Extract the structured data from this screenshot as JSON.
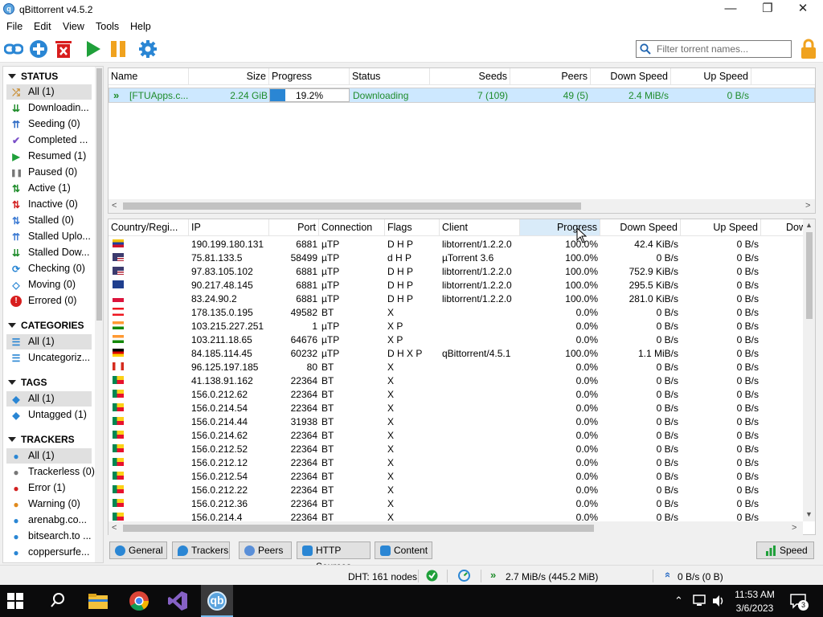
{
  "window": {
    "title": "qBittorrent v4.5.2",
    "minimize": "—",
    "maximize": "❐",
    "close": "✕"
  },
  "menu": [
    "File",
    "Edit",
    "View",
    "Tools",
    "Help"
  ],
  "filter": {
    "placeholder": "Filter torrent names..."
  },
  "sidebar": {
    "status_header": "STATUS",
    "status": [
      {
        "label": "All (1)",
        "icon": "shuffle-icon",
        "color": "#c98a2a"
      },
      {
        "label": "Downloadin...",
        "icon": "download-icon",
        "color": "#1f8c2b"
      },
      {
        "label": "Seeding (0)",
        "icon": "upload-icon",
        "color": "#2f6cc5"
      },
      {
        "label": "Completed ...",
        "icon": "check-icon",
        "color": "#7a4fc8"
      },
      {
        "label": "Resumed (1)",
        "icon": "play-icon",
        "color": "#1fa03a"
      },
      {
        "label": "Paused (0)",
        "icon": "pause-icon",
        "color": "#777777"
      },
      {
        "label": "Active (1)",
        "icon": "active-arrows-icon",
        "color": "#1f8c2b"
      },
      {
        "label": "Inactive (0)",
        "icon": "inactive-arrows-icon",
        "color": "#d22020"
      },
      {
        "label": "Stalled (0)",
        "icon": "stalled-arrows-icon",
        "color": "#3d7bd3"
      },
      {
        "label": "Stalled Uplo...",
        "icon": "stalled-upload-icon",
        "color": "#3d7bd3"
      },
      {
        "label": "Stalled Dow...",
        "icon": "stalled-download-icon",
        "color": "#1f8c2b"
      },
      {
        "label": "Checking (0)",
        "icon": "refresh-icon",
        "color": "#2a86d4"
      },
      {
        "label": "Moving (0)",
        "icon": "moving-icon",
        "color": "#2a86d4"
      },
      {
        "label": "Errored (0)",
        "icon": "error-icon",
        "color": "#d81e1e"
      }
    ],
    "categories_header": "CATEGORIES",
    "categories": [
      {
        "label": "All (1)",
        "icon": "list-icon"
      },
      {
        "label": "Uncategoriz...",
        "icon": "list-icon"
      }
    ],
    "tags_header": "TAGS",
    "tags": [
      {
        "label": "All (1)",
        "icon": "tag-icon"
      },
      {
        "label": "Untagged (1)",
        "icon": "tag-icon"
      }
    ],
    "trackers_header": "TRACKERS",
    "trackers": [
      {
        "label": "All (1)",
        "icon": "pin-icon",
        "color": "#2a86d4"
      },
      {
        "label": "Trackerless (0)",
        "icon": "pin-icon",
        "color": "#777777"
      },
      {
        "label": "Error (1)",
        "icon": "pin-icon",
        "color": "#d22020"
      },
      {
        "label": "Warning (0)",
        "icon": "pin-icon",
        "color": "#e08a1e"
      },
      {
        "label": "arenabg.co...",
        "icon": "pin-icon",
        "color": "#2a86d4"
      },
      {
        "label": "bitsearch.to ...",
        "icon": "pin-icon",
        "color": "#2a86d4"
      },
      {
        "label": "coppersurfe...",
        "icon": "pin-icon",
        "color": "#2a86d4"
      }
    ]
  },
  "torrents": {
    "headers": [
      "Name",
      "Size",
      "Progress",
      "Status",
      "Seeds",
      "Peers",
      "Down Speed",
      "Up Speed"
    ],
    "rows": [
      {
        "name": "[FTUApps.c...",
        "size": "2.24 GiB",
        "progress": "19.2%",
        "progress_value": 0.192,
        "status": "Downloading",
        "seeds": "7 (109)",
        "peers": "49 (5)",
        "down": "2.4 MiB/s",
        "up": "0 B/s"
      }
    ]
  },
  "peers": {
    "headers": [
      "Country/Regi...",
      "IP",
      "Port",
      "Connection",
      "Flags",
      "Client",
      "Progress",
      "Down Speed",
      "Up Speed",
      "Dow"
    ],
    "rows": [
      {
        "flag": "ve",
        "ip": "190.199.180.131",
        "port": "6881",
        "conn": "µTP",
        "flags": "D H P",
        "client": "libtorrent/1.2.2.0",
        "progress": "100.0%",
        "down": "42.4 KiB/s",
        "up": "0 B/s"
      },
      {
        "flag": "us",
        "ip": "75.81.133.5",
        "port": "58499",
        "conn": "µTP",
        "flags": "d H P",
        "client": "µTorrent 3.6",
        "progress": "100.0%",
        "down": "0 B/s",
        "up": "0 B/s"
      },
      {
        "flag": "us",
        "ip": "97.83.105.102",
        "port": "6881",
        "conn": "µTP",
        "flags": "D H P",
        "client": "libtorrent/1.2.2.0",
        "progress": "100.0%",
        "down": "752.9 KiB/s",
        "up": "0 B/s"
      },
      {
        "flag": "gb",
        "ip": "90.217.48.145",
        "port": "6881",
        "conn": "µTP",
        "flags": "D H P",
        "client": "libtorrent/1.2.2.0",
        "progress": "100.0%",
        "down": "295.5 KiB/s",
        "up": "0 B/s"
      },
      {
        "flag": "pl",
        "ip": "83.24.90.2",
        "port": "6881",
        "conn": "µTP",
        "flags": "D H P",
        "client": "libtorrent/1.2.2.0",
        "progress": "100.0%",
        "down": "281.0 KiB/s",
        "up": "0 B/s"
      },
      {
        "flag": "lb",
        "ip": "178.135.0.195",
        "port": "49582",
        "conn": "BT",
        "flags": "X",
        "client": "",
        "progress": "0.0%",
        "down": "0 B/s",
        "up": "0 B/s"
      },
      {
        "flag": "in",
        "ip": "103.215.227.251",
        "port": "1",
        "conn": "µTP",
        "flags": "X P",
        "client": "",
        "progress": "0.0%",
        "down": "0 B/s",
        "up": "0 B/s"
      },
      {
        "flag": "in",
        "ip": "103.211.18.65",
        "port": "64676",
        "conn": "µTP",
        "flags": "X P",
        "client": "",
        "progress": "0.0%",
        "down": "0 B/s",
        "up": "0 B/s"
      },
      {
        "flag": "de",
        "ip": "84.185.114.45",
        "port": "60232",
        "conn": "µTP",
        "flags": "D H X P",
        "client": "qBittorrent/4.5.1",
        "progress": "100.0%",
        "down": "1.1 MiB/s",
        "up": "0 B/s"
      },
      {
        "flag": "ca",
        "ip": "96.125.197.185",
        "port": "80",
        "conn": "BT",
        "flags": "X",
        "client": "",
        "progress": "0.0%",
        "down": "0 B/s",
        "up": "0 B/s"
      },
      {
        "flag": "bj",
        "ip": "41.138.91.162",
        "port": "22364",
        "conn": "BT",
        "flags": "X",
        "client": "",
        "progress": "0.0%",
        "down": "0 B/s",
        "up": "0 B/s"
      },
      {
        "flag": "bj",
        "ip": "156.0.212.62",
        "port": "22364",
        "conn": "BT",
        "flags": "X",
        "client": "",
        "progress": "0.0%",
        "down": "0 B/s",
        "up": "0 B/s"
      },
      {
        "flag": "bj",
        "ip": "156.0.214.54",
        "port": "22364",
        "conn": "BT",
        "flags": "X",
        "client": "",
        "progress": "0.0%",
        "down": "0 B/s",
        "up": "0 B/s"
      },
      {
        "flag": "bj",
        "ip": "156.0.214.44",
        "port": "31938",
        "conn": "BT",
        "flags": "X",
        "client": "",
        "progress": "0.0%",
        "down": "0 B/s",
        "up": "0 B/s"
      },
      {
        "flag": "bj",
        "ip": "156.0.214.62",
        "port": "22364",
        "conn": "BT",
        "flags": "X",
        "client": "",
        "progress": "0.0%",
        "down": "0 B/s",
        "up": "0 B/s"
      },
      {
        "flag": "bj",
        "ip": "156.0.212.52",
        "port": "22364",
        "conn": "BT",
        "flags": "X",
        "client": "",
        "progress": "0.0%",
        "down": "0 B/s",
        "up": "0 B/s"
      },
      {
        "flag": "bj",
        "ip": "156.0.212.12",
        "port": "22364",
        "conn": "BT",
        "flags": "X",
        "client": "",
        "progress": "0.0%",
        "down": "0 B/s",
        "up": "0 B/s"
      },
      {
        "flag": "bj",
        "ip": "156.0.212.54",
        "port": "22364",
        "conn": "BT",
        "flags": "X",
        "client": "",
        "progress": "0.0%",
        "down": "0 B/s",
        "up": "0 B/s"
      },
      {
        "flag": "bj",
        "ip": "156.0.212.22",
        "port": "22364",
        "conn": "BT",
        "flags": "X",
        "client": "",
        "progress": "0.0%",
        "down": "0 B/s",
        "up": "0 B/s"
      },
      {
        "flag": "bj",
        "ip": "156.0.212.36",
        "port": "22364",
        "conn": "BT",
        "flags": "X",
        "client": "",
        "progress": "0.0%",
        "down": "0 B/s",
        "up": "0 B/s"
      },
      {
        "flag": "bj",
        "ip": "156.0.214.4",
        "port": "22364",
        "conn": "BT",
        "flags": "X",
        "client": "",
        "progress": "0.0%",
        "down": "0 B/s",
        "up": "0 B/s"
      }
    ]
  },
  "tabs": [
    "General",
    "Trackers",
    "Peers",
    "HTTP Sources",
    "Content"
  ],
  "speed_button": "Speed",
  "statusbar": {
    "dht": "DHT: 161 nodes",
    "download": "2.7 MiB/s (445.2 MiB)",
    "upload": "0 B/s (0 B)"
  },
  "taskbar": {
    "time": "11:53 AM",
    "date": "3/6/2023",
    "notifications": "3"
  }
}
